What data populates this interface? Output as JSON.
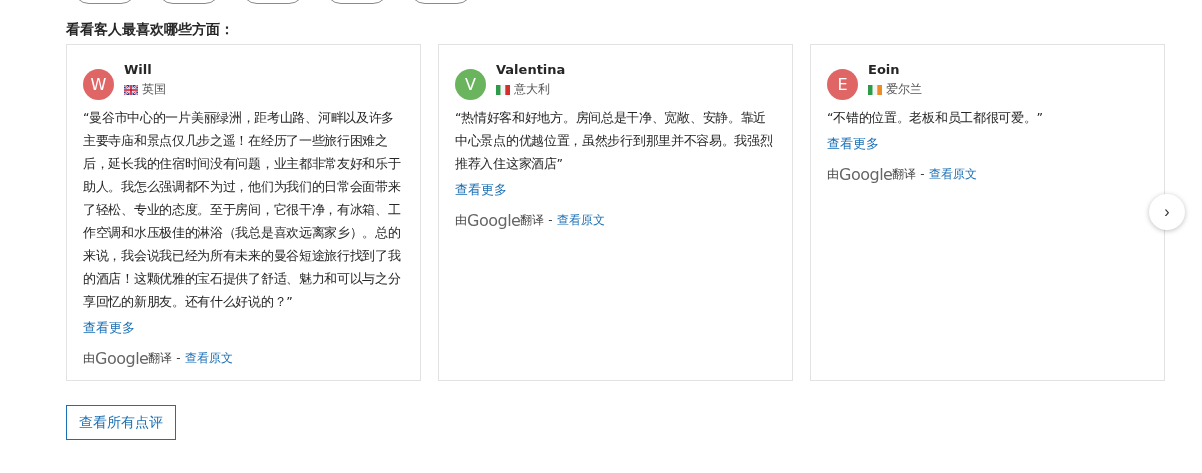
{
  "filter_chips": [
    {
      "kind": "chip"
    },
    {
      "kind": "chip"
    },
    {
      "kind": "chip"
    },
    {
      "kind": "chip"
    },
    {
      "kind": "chip"
    }
  ],
  "heading": "看看客人最喜欢哪些方面：",
  "reviews": [
    {
      "initial": "W",
      "color": "#e06666",
      "name": "Will",
      "flag": {
        "kind": "uk"
      },
      "country": "英国",
      "text": "“曼谷市中心的一片美丽绿洲，距考山路、河畔以及许多主要寺庙和景点仅几步之遥！在经历了一些旅行困难之后，延长我的住宿时间没有问题，业主都非常友好和乐于助人。我怎么强调都不为过，他们为我们的日常会面带来了轻松、专业的态度。至于房间，它很干净，有冰箱、工作空调和水压极佳的淋浴（我总是喜欢远离家乡）。总的来说，我会说我已经为所有未来的曼谷短途旅行找到了我的酒店！这颗优雅的宝石提供了舒适、魅力和可以与之分享回忆的新朋友。还有什么好说的？”",
      "more": "查看更多",
      "by": "由",
      "brand": "Google",
      "translated": "翻译 -",
      "original": "查看原文"
    },
    {
      "initial": "V",
      "color": "#6bb45e",
      "name": "Valentina",
      "flag": {
        "kind": "it"
      },
      "country": "意大利",
      "text": "“热情好客和好地方。房间总是干净、宽敞、安静。靠近中心景点的优越位置，虽然步行到那里并不容易。我强烈推荐入住这家酒店”",
      "more": "查看更多",
      "by": "由",
      "brand": "Google",
      "translated": "翻译 -",
      "original": "查看原文"
    },
    {
      "initial": "E",
      "color": "#e06666",
      "name": "Eoin",
      "flag": {
        "kind": "ie"
      },
      "country": "爱尔兰",
      "text": "“不错的位置。老板和员工都很可爱。”",
      "more": "查看更多",
      "by": "由",
      "brand": "Google",
      "translated": "翻译 -",
      "original": "查看原文"
    }
  ],
  "next_button": "›",
  "all_reviews_button": "查看所有点评"
}
